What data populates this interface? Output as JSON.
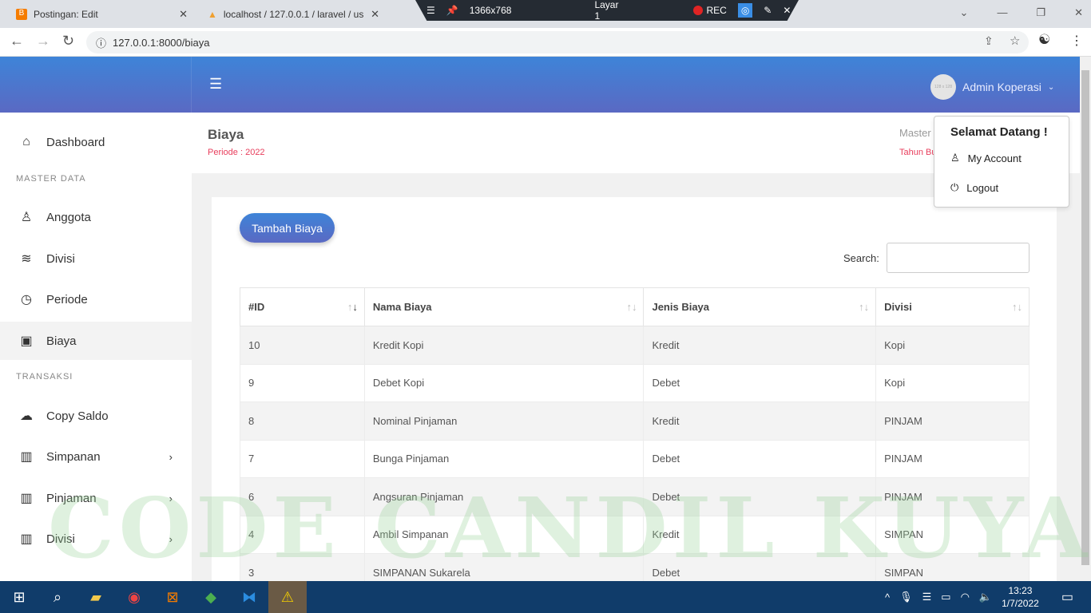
{
  "browser": {
    "tabs": [
      {
        "title": "Postingan: Edit"
      },
      {
        "title": "localhost / 127.0.0.1 / laravel / us"
      }
    ],
    "url": "127.0.0.1:8000/biaya"
  },
  "recorder": {
    "resolution": "1366x768",
    "layer": "Layar 1",
    "rec": "REC"
  },
  "header": {
    "user": "Admin Koperasi",
    "avatar_text": "128 x 128"
  },
  "sidebar": {
    "items": [
      {
        "label": "Dashboard",
        "icon": "home-icon"
      },
      {
        "section": "MASTER DATA"
      },
      {
        "label": "Anggota",
        "icon": "user-icon"
      },
      {
        "label": "Divisi",
        "icon": "layers-icon"
      },
      {
        "label": "Periode",
        "icon": "clock-icon"
      },
      {
        "label": "Biaya",
        "icon": "money-icon"
      },
      {
        "section": "TRANSAKSI"
      },
      {
        "label": "Copy Saldo",
        "icon": "cloud-upload-icon"
      },
      {
        "label": "Simpanan",
        "icon": "map-icon"
      },
      {
        "label": "Pinjaman",
        "icon": "map-icon"
      },
      {
        "label": "Divisi",
        "icon": "map-icon"
      }
    ]
  },
  "page": {
    "title": "Biaya",
    "period": "Periode : 2022",
    "breadcrumb": "Master",
    "breadcrumb2": "Tahun Bu"
  },
  "card": {
    "add_button": "Tambah Biaya",
    "search_label": "Search:",
    "search_value": ""
  },
  "table": {
    "columns": [
      "#ID",
      "Nama Biaya",
      "Jenis Biaya",
      "Divisi"
    ],
    "rows": [
      [
        "10",
        "Kredit Kopi",
        "Kredit",
        "Kopi"
      ],
      [
        "9",
        "Debet Kopi",
        "Debet",
        "Kopi"
      ],
      [
        "8",
        "Nominal Pinjaman",
        "Kredit",
        "PINJAM"
      ],
      [
        "7",
        "Bunga Pinjaman",
        "Debet",
        "PINJAM"
      ],
      [
        "6",
        "Angsuran Pinjaman",
        "Debet",
        "PINJAM"
      ],
      [
        "4",
        "Ambil Simpanan",
        "Kredit",
        "SIMPAN"
      ],
      [
        "3",
        "SIMPANAN Sukarela",
        "Debet",
        "SIMPAN"
      ]
    ]
  },
  "dropdown": {
    "title": "Selamat Datang !",
    "items": [
      "My Account",
      "Logout"
    ]
  },
  "watermark": "CODE CANDIL KUYA",
  "taskbar": {
    "time": "13:23",
    "date": "1/7/2022"
  }
}
